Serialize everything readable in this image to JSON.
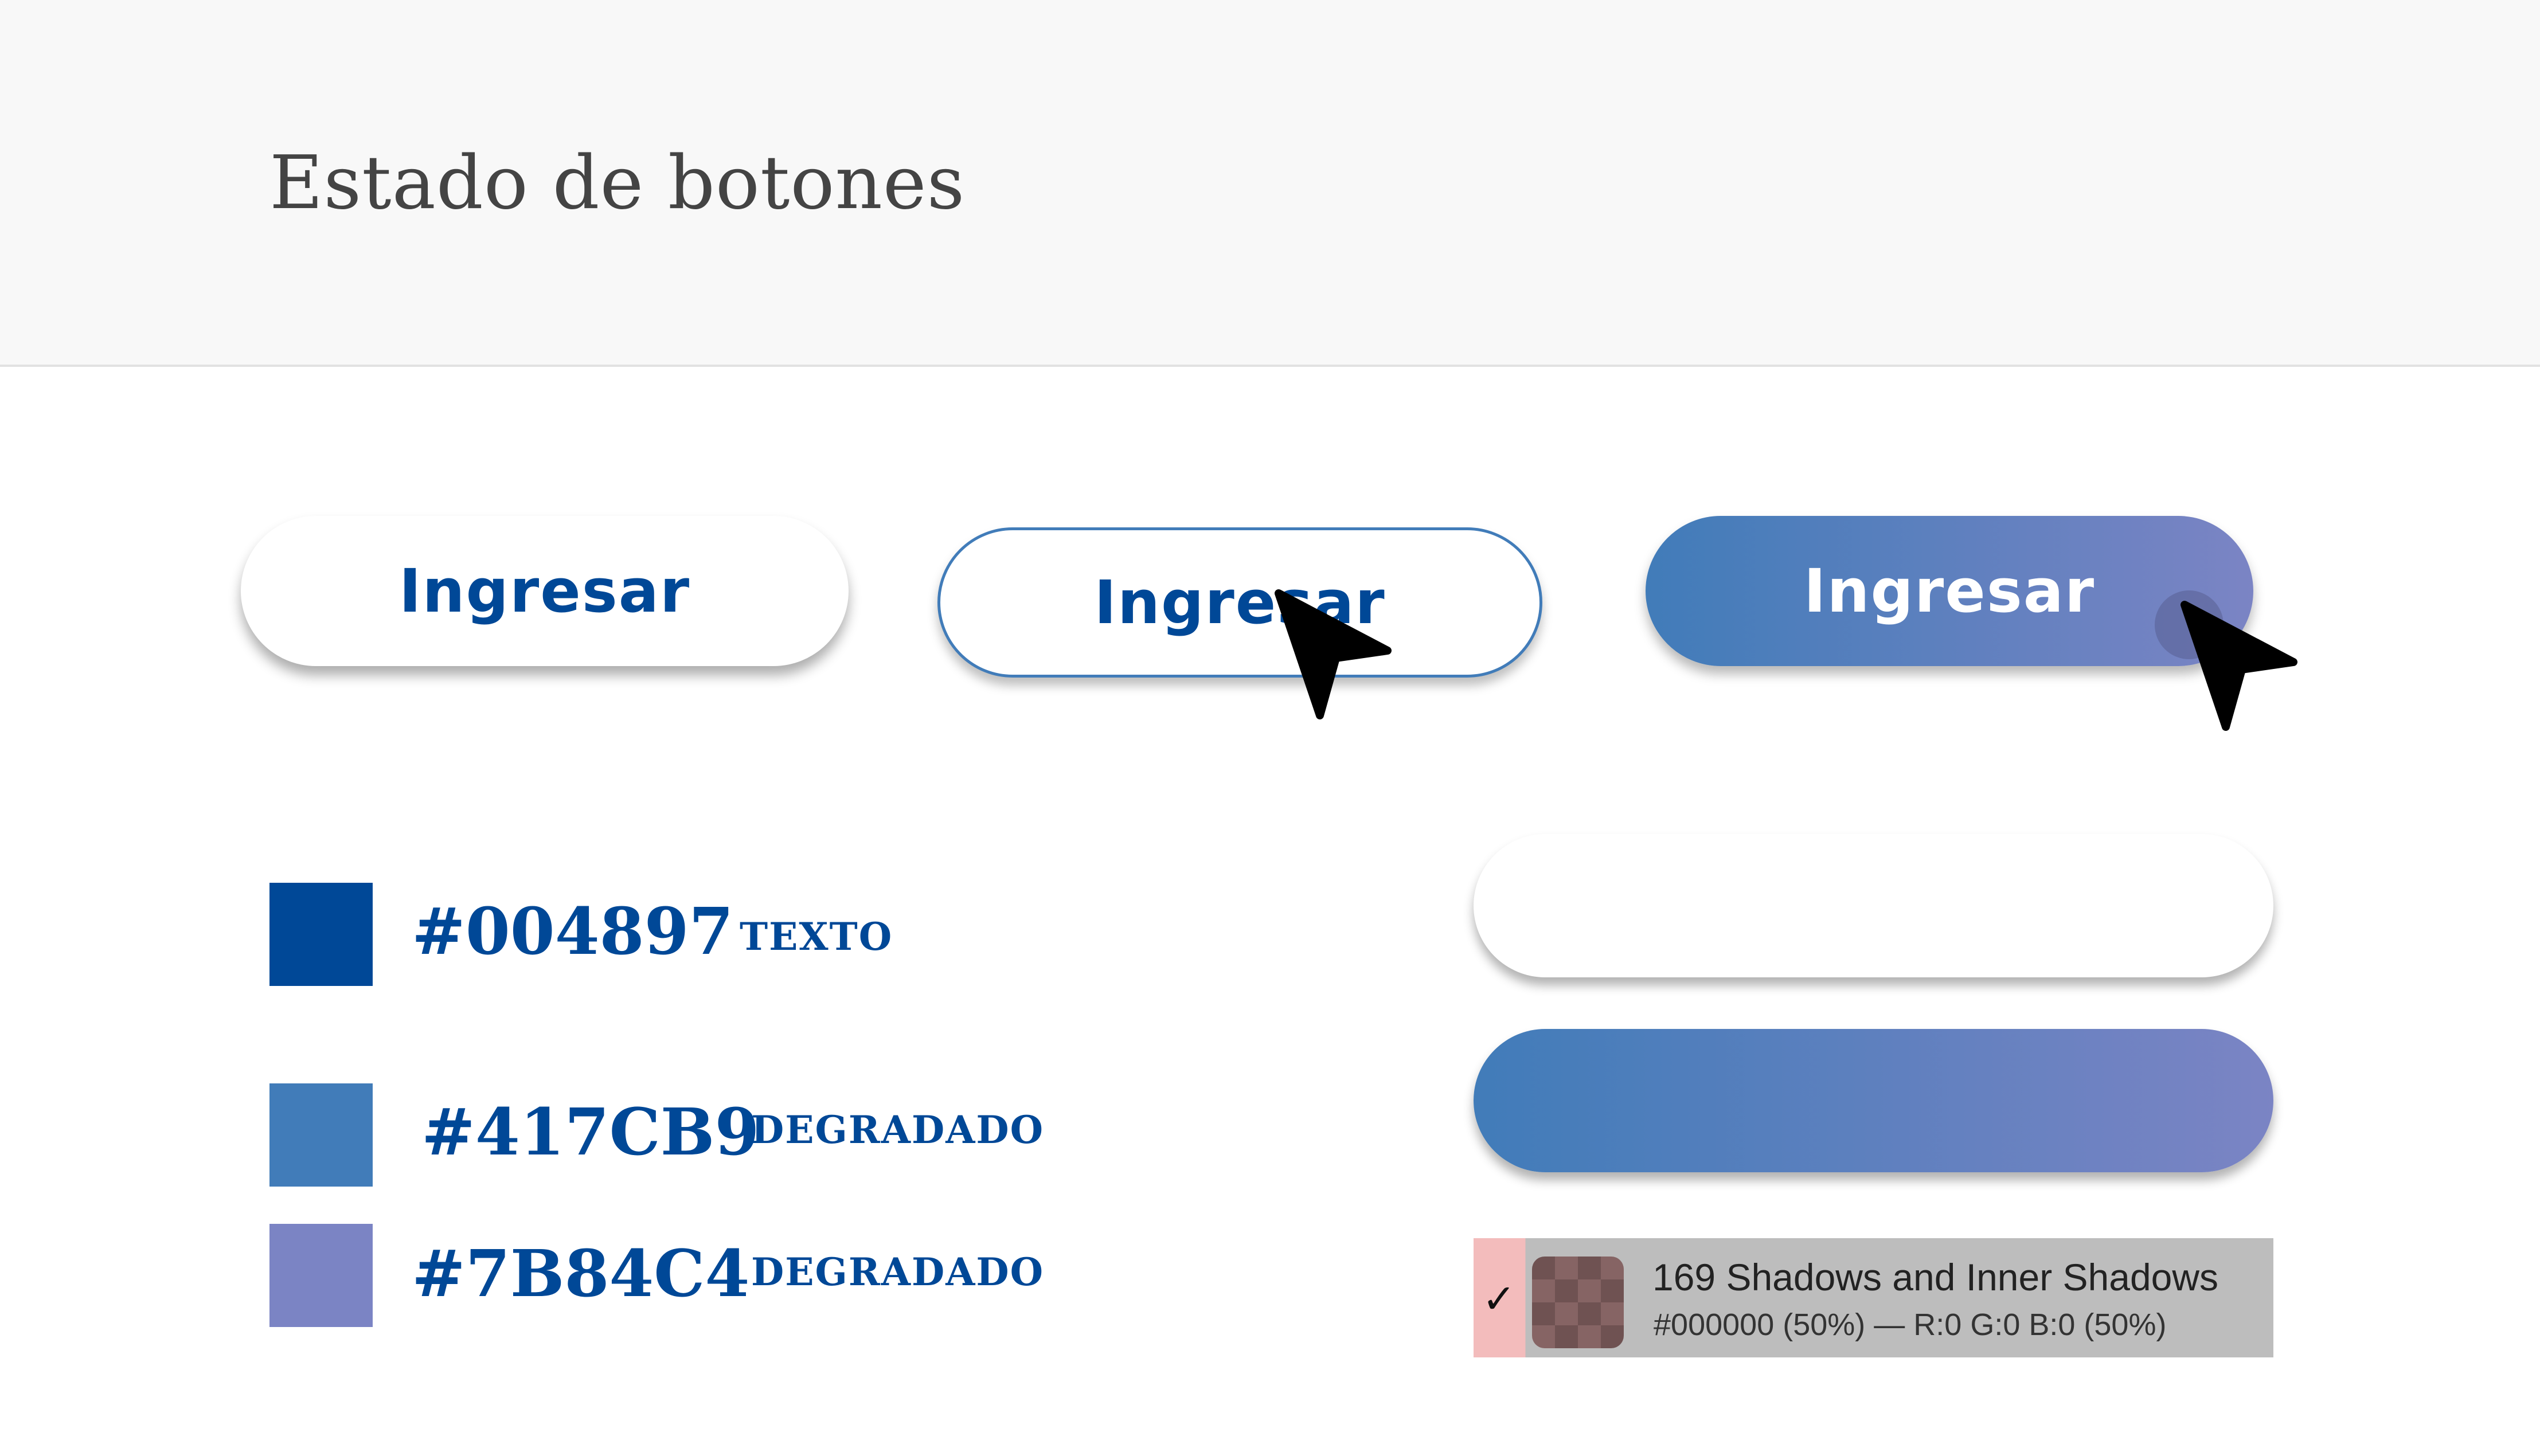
{
  "header": {
    "title": "Estado de botones"
  },
  "buttons": {
    "normal_label": "Ingresar",
    "hover_label": "Ingresar",
    "active_label": "Ingresar"
  },
  "colors": [
    {
      "hex": "#004897",
      "tag": "TEXTO",
      "color": "#004897"
    },
    {
      "hex": "#417CB9",
      "tag": "DEGRADADO",
      "color": "#417CB9"
    },
    {
      "hex": "#7B84C4",
      "tag": "DEGRADADO",
      "color": "#7B84C4"
    }
  ],
  "shadow_style": {
    "title": "169 Shadows and Inner Shadows",
    "detail": "#000000 (50%) — R:0 G:0 B:0 (50%)",
    "check": "✓"
  },
  "icons": {
    "cursor": "arrow-cursor-icon",
    "swatch": "checkerboard-swatch-icon"
  }
}
